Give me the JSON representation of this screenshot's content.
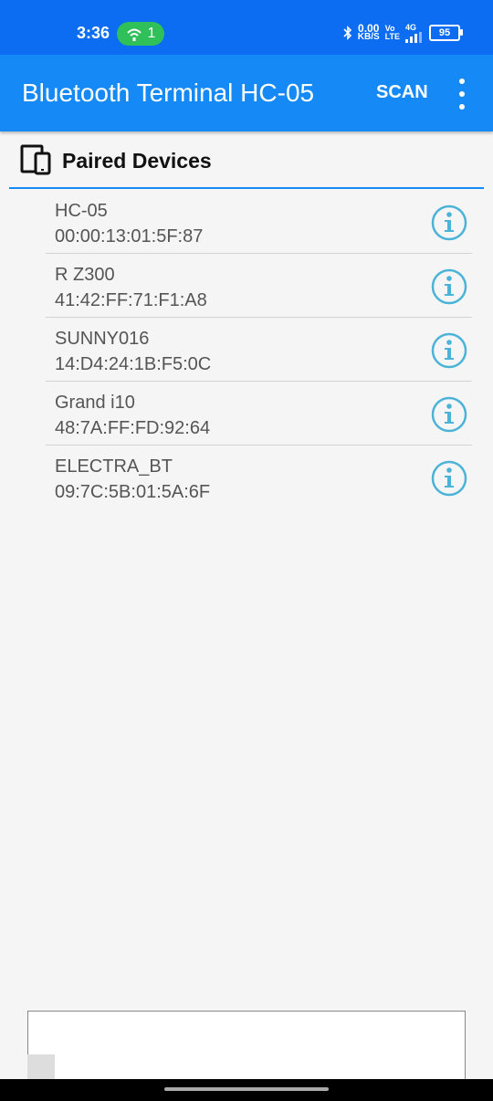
{
  "status_bar": {
    "time": "3:36",
    "hotspot_count": "1",
    "speed_value": "0.00",
    "speed_unit": "KB/S",
    "volte_top": "Vo",
    "volte_bottom": "LTE",
    "network": "4G",
    "battery": "95"
  },
  "app_bar": {
    "title": "Bluetooth Terminal HC-05",
    "scan_label": "SCAN",
    "more_icon": "more-vertical-icon"
  },
  "section": {
    "title": "Paired Devices",
    "icon": "devices-icon"
  },
  "devices": [
    {
      "name": "HC-05",
      "address": "00:00:13:01:5F:87"
    },
    {
      "name": "R Z300",
      "address": "41:42:FF:71:F1:A8"
    },
    {
      "name": "SUNNY016",
      "address": "14:D4:24:1B:F5:0C"
    },
    {
      "name": "Grand i10",
      "address": "48:7A:FF:FD:92:64"
    },
    {
      "name": "ELECTRA_BT",
      "address": "09:7C:5B:01:5A:6F"
    }
  ],
  "colors": {
    "status_bar": "#0c6df2",
    "app_bar": "#1589f6",
    "info_icon": "#4bb3d8",
    "hotspot_badge": "#30c05a"
  }
}
